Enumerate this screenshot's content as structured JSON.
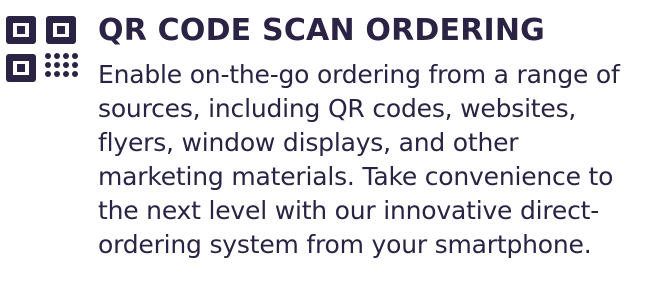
{
  "feature": {
    "title": "QR CODE SCAN ORDERING",
    "description": "Enable on-the-go ordering from a range of sources, including QR codes, websites, flyers, window displays, and other marketing materials. Take convenience to the next level with our innovative direct-ordering system from your smartphone.",
    "icon": "qr-code-icon"
  },
  "colors": {
    "text": "#2b2344",
    "icon": "#2b2344",
    "background": "#ffffff"
  }
}
